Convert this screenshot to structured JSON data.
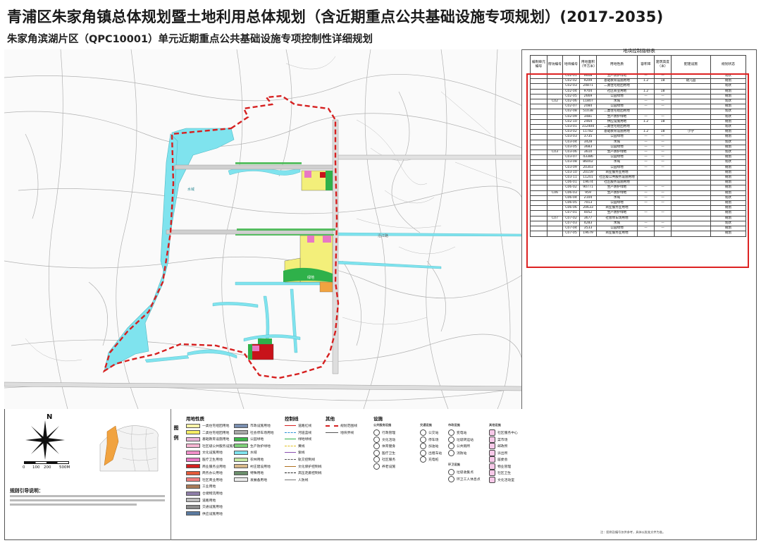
{
  "titles": {
    "main": "青浦区朱家角镇总体规划暨土地利用总体规划（含近期重点公共基础设施专项规划）(2017-2035)",
    "sub": "朱家角滨湖片区（QPC10001）单元近期重点公共基础设施专项控制性详细规划"
  },
  "map": {
    "labels": [
      "绿地",
      "水域",
      "沿江路"
    ],
    "colors": {
      "water": "#7fe3ee",
      "boundary": "#d62020",
      "road": "#9a9a9a",
      "residential": "#f3ef7a",
      "green": "#2fb14a",
      "pink": "#e878c4",
      "red": "#c8131a",
      "orange": "#f1a340"
    }
  },
  "table": {
    "title": "地块控制指标表",
    "headers": [
      "编制单元编号",
      "街坊编号",
      "地块编号",
      "用地面积（平方米）",
      "用地性质",
      "容积率",
      "建筑高度（米）",
      "配建设施",
      "规划状态"
    ],
    "rows": [
      [
        "",
        "",
        "C02-01",
        "9608",
        "生产防护绿地",
        "—",
        "—",
        "",
        "现状"
      ],
      [
        "",
        "",
        "C02-02",
        "9209",
        "基础教育设施用地",
        "1.2",
        "18",
        "幼儿园",
        "规划"
      ],
      [
        "",
        "",
        "C02-03",
        "24871",
        "二类住宅组团用地",
        "",
        "",
        "",
        "现状"
      ],
      [
        "",
        "",
        "C02-04",
        "9704",
        "社区商业用地",
        "1.2",
        "18",
        "",
        "规划"
      ],
      [
        "",
        "",
        "C02-05",
        "2669",
        "公园绿地",
        "—",
        "—",
        "",
        "规划"
      ],
      [
        "",
        "C02",
        "C02-06",
        "11807",
        "水域",
        "—",
        "—",
        "",
        "现状"
      ],
      [
        "",
        "",
        "C02-07",
        "2084",
        "公园绿地",
        "—",
        "—",
        "",
        "规划"
      ],
      [
        "",
        "",
        "C02-08",
        "51038",
        "二类住宅组团用地",
        "",
        "",
        "",
        "现状"
      ],
      [
        "",
        "",
        "C02-09",
        "3481",
        "生产防护绿地",
        "—",
        "—",
        "",
        "现状"
      ],
      [
        "",
        "",
        "C02-10",
        "2464",
        "供应设施用地",
        "1.2",
        "18",
        "",
        "规划"
      ],
      [
        "",
        "",
        "C03-01",
        "312400",
        "二类住宅组团用地",
        "",
        "",
        "",
        "现状"
      ],
      [
        "",
        "",
        "C03-02",
        "11782",
        "基础教育设施用地",
        "1.2",
        "18",
        "小学",
        "规划"
      ],
      [
        "",
        "",
        "C03-03",
        "3735",
        "公园绿地",
        "—",
        "—",
        "",
        "规划"
      ],
      [
        "",
        "",
        "C03-04",
        "3428",
        "水域",
        "—",
        "—",
        "",
        "现状"
      ],
      [
        "",
        "",
        "C03-05",
        "3683",
        "公园绿地",
        "—",
        "—",
        "",
        "规划"
      ],
      [
        "",
        "C03",
        "C03-06",
        "3610",
        "生产防护绿地",
        "—",
        "—",
        "",
        "现状"
      ],
      [
        "",
        "",
        "C03-07",
        "43386",
        "公园绿地",
        "—",
        "—",
        "",
        "规划"
      ],
      [
        "",
        "",
        "C03-08",
        "86002",
        "水域",
        "—",
        "—",
        "",
        "现状"
      ],
      [
        "",
        "",
        "C03-09",
        "20303",
        "公园绿地",
        "—",
        "—",
        "",
        "规划"
      ],
      [
        "",
        "",
        "C03-10",
        "20159",
        "商业服务业用地",
        "",
        "",
        "",
        "规划"
      ],
      [
        "",
        "",
        "C03-11",
        "11201",
        "社区级公共服务设施用地",
        "",
        "",
        "",
        "规划"
      ],
      [
        "",
        "",
        "C06-01",
        "19674",
        "社区服务设施用地",
        "",
        "",
        "",
        "规划"
      ],
      [
        "",
        "",
        "C06-02",
        "90771",
        "生产防护绿地",
        "—",
        "—",
        "",
        "规划"
      ],
      [
        "",
        "C06",
        "C06-03",
        "959",
        "生产防护绿地",
        "—",
        "—",
        "",
        "规划"
      ],
      [
        "",
        "",
        "C06-04",
        "2104",
        "水域",
        "—",
        "—",
        "",
        "现状"
      ],
      [
        "",
        "",
        "C06-05",
        "7013",
        "公园绿地",
        "—",
        "—",
        "",
        "规划"
      ],
      [
        "",
        "",
        "C06-06",
        "20633",
        "商业服务业用地",
        "",
        "",
        "",
        "规划"
      ],
      [
        "",
        "",
        "C07-01",
        "4052",
        "生产防护绿地",
        "—",
        "—",
        "",
        "规划"
      ],
      [
        "",
        "C07",
        "C07-02",
        "3677",
        "社会停车场用地",
        "",
        "",
        "",
        "规划"
      ],
      [
        "",
        "",
        "C07-03",
        "4283",
        "水域",
        "—",
        "—",
        "",
        "现状"
      ],
      [
        "",
        "",
        "C07-04",
        "3533",
        "公园绿地",
        "—",
        "—",
        "",
        "规划"
      ],
      [
        "",
        "",
        "C07-05",
        "19679",
        "商业服务业用地",
        "",
        "",
        "",
        "规划"
      ]
    ]
  },
  "scale": {
    "ticks": [
      "0",
      "100",
      "200",
      "500M"
    ],
    "north": "N"
  },
  "legend": {
    "side_label": "图例",
    "landuse_head": "用地性质",
    "landuse": [
      {
        "label": "一类住宅组团用地",
        "color": "#fff4a8"
      },
      {
        "label": "二类住宅组团用地",
        "color": "#f6ee63"
      },
      {
        "label": "基础教育设施用地",
        "color": "#e9b4d7"
      },
      {
        "label": "社区级公共服务设施用地",
        "color": "#f7b6d2"
      },
      {
        "label": "文化设施用地",
        "color": "#f08fc8"
      },
      {
        "label": "医疗卫生用地",
        "color": "#e878c4"
      },
      {
        "label": "商业服务业用地",
        "color": "#d31f1f"
      },
      {
        "label": "商务办公用地",
        "color": "#e35a3a"
      },
      {
        "label": "社区商业用地",
        "color": "#ef7f7f"
      },
      {
        "label": "工业用地",
        "color": "#a97b58"
      },
      {
        "label": "仓储物流用地",
        "color": "#8e7ea8"
      },
      {
        "label": "道路用地",
        "color": "#bdbdbd"
      },
      {
        "label": "交通设施用地",
        "color": "#8c8c8c"
      },
      {
        "label": "供应设施用地",
        "color": "#5a7aa0"
      }
    ],
    "landuse2": [
      {
        "label": "市政设施用地",
        "color": "#7a8fb0"
      },
      {
        "label": "社会停车场用地",
        "color": "#a9a9a9"
      },
      {
        "label": "公园绿地",
        "color": "#3db54a"
      },
      {
        "label": "生产防护绿地",
        "color": "#7fd07a"
      },
      {
        "label": "水域",
        "color": "#7fe3ee"
      },
      {
        "label": "农林用地",
        "color": "#c7e8a3"
      },
      {
        "label": "村庄建设用地",
        "color": "#d8b98a"
      },
      {
        "label": "特殊用地",
        "color": "#6b8e6b"
      },
      {
        "label": "发展备用地",
        "color": "#ececec"
      }
    ],
    "control_head": "控制线",
    "control": [
      "道路红线",
      "河道蓝线",
      "绿地绿线",
      "黄线",
      "紫线",
      "轨交控制线",
      "文化保护控制线",
      "高压走廊控制线",
      "人防线"
    ],
    "other_head": "其他",
    "other": [
      "规划范围线",
      "地块界线"
    ],
    "facility_head": "设施",
    "facility_groups": [
      {
        "name": "公共服务设施",
        "items": [
          "行政管理",
          "文化活动",
          "体育健身",
          "医疗卫生",
          "社区服务",
          "养老设施"
        ]
      },
      {
        "name": "交通设施",
        "items": [
          "公交站",
          "停车场",
          "加油站",
          "出租车站",
          "充电桩"
        ]
      },
      {
        "name": "市政设施",
        "items": [
          "变电站",
          "垃圾转运站",
          "公共厕所",
          "消防站"
        ]
      },
      {
        "name": "环卫设施",
        "items": [
          "垃圾收集点",
          "环卫工人休息点"
        ]
      },
      {
        "name": "其他设施",
        "items": [
          "社区服务中心",
          "菜市场",
          "邮政所",
          "派出所",
          "居委会",
          "物业管理",
          "社区卫生",
          "文化活动室"
        ]
      }
    ]
  },
  "notes": {
    "head": "规则引导说明：",
    "right_note": "注：图例及编号仅供参考，具体以批准文件为准。"
  }
}
